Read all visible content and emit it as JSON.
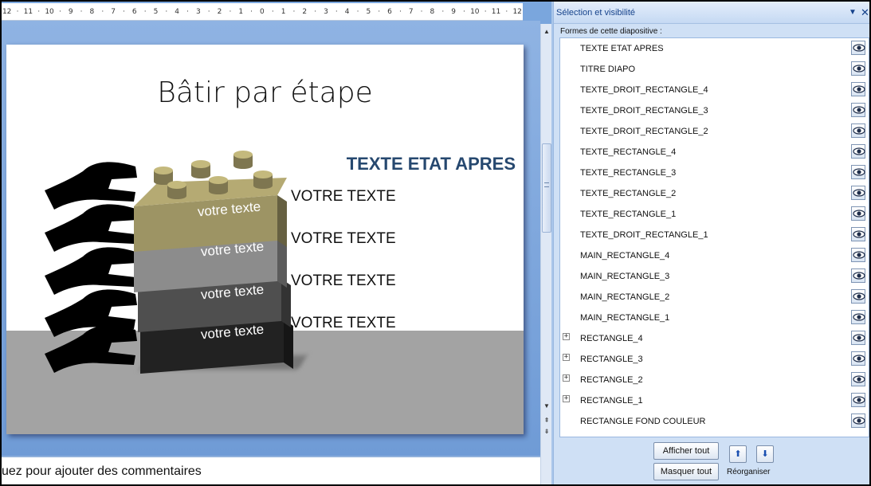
{
  "ruler": {
    "ticks": [
      "12",
      "·",
      "11",
      "·",
      "10",
      "·",
      "9",
      "·",
      "8",
      "·",
      "7",
      "·",
      "6",
      "·",
      "5",
      "·",
      "4",
      "·",
      "3",
      "·",
      "2",
      "·",
      "1",
      "·",
      "0",
      "·",
      "1",
      "·",
      "2",
      "·",
      "3",
      "·",
      "4",
      "·",
      "5",
      "·",
      "6",
      "·",
      "7",
      "·",
      "8",
      "·",
      "9",
      "·",
      "10",
      "·",
      "11",
      "·",
      "12"
    ]
  },
  "slide": {
    "title": "Bâtir par étape",
    "subtitle": "TEXTE ETAT APRES",
    "side_texts": [
      "VOTRE TEXTE",
      "VOTRE TEXTE",
      "VOTRE TEXTE",
      "VOTRE TEXTE"
    ],
    "brick_texts": [
      "votre texte",
      "votre texte",
      "votre texte",
      "votre texte"
    ],
    "brick_colors": [
      "#9d9464",
      "#8c8c8c",
      "#4f4f4f",
      "#222222"
    ]
  },
  "notes": {
    "text": "uez pour ajouter des commentaires"
  },
  "pane": {
    "title": "Sélection et visibilité",
    "dropdown_icon": "▼",
    "close_icon": "✕",
    "shapes_label": "Formes de cette diapositive :",
    "items": [
      {
        "label": "TEXTE ETAT APRES",
        "expandable": false
      },
      {
        "label": "TITRE DIAPO",
        "expandable": false
      },
      {
        "label": "TEXTE_DROIT_RECTANGLE_4",
        "expandable": false
      },
      {
        "label": "TEXTE_DROIT_RECTANGLE_3",
        "expandable": false
      },
      {
        "label": "TEXTE_DROIT_RECTANGLE_2",
        "expandable": false
      },
      {
        "label": "TEXTE_RECTANGLE_4",
        "expandable": false
      },
      {
        "label": "TEXTE_RECTANGLE_3",
        "expandable": false
      },
      {
        "label": "TEXTE_RECTANGLE_2",
        "expandable": false
      },
      {
        "label": "TEXTE_RECTANGLE_1",
        "expandable": false
      },
      {
        "label": "TEXTE_DROIT_RECTANGLE_1",
        "expandable": false
      },
      {
        "label": "MAIN_RECTANGLE_4",
        "expandable": false
      },
      {
        "label": "MAIN_RECTANGLE_3",
        "expandable": false
      },
      {
        "label": "MAIN_RECTANGLE_2",
        "expandable": false
      },
      {
        "label": "MAIN_RECTANGLE_1",
        "expandable": false
      },
      {
        "label": "RECTANGLE_4",
        "expandable": true
      },
      {
        "label": "RECTANGLE_3",
        "expandable": true
      },
      {
        "label": "RECTANGLE_2",
        "expandable": true
      },
      {
        "label": "RECTANGLE_1",
        "expandable": true
      },
      {
        "label": "RECTANGLE FOND COULEUR",
        "expandable": false
      }
    ],
    "show_all": "Afficher tout",
    "hide_all": "Masquer tout",
    "reorder_label": "Réorganiser",
    "up_icon": "⬆",
    "down_icon": "⬇"
  },
  "scrollbar": {
    "up_icon": "▲",
    "down_icon": "▼",
    "prev_icon": "⇞",
    "next_icon": "⇟"
  }
}
